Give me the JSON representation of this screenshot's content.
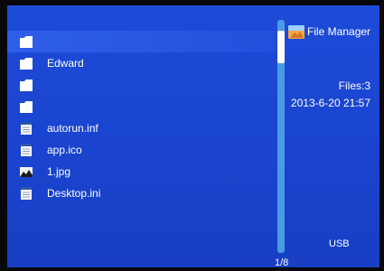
{
  "app": {
    "title": "File Manager",
    "icon": "file-manager-icon"
  },
  "files": [
    {
      "name": "",
      "icon": "folder-icon",
      "selected": true
    },
    {
      "name": "Edward",
      "icon": "folder-icon",
      "selected": false
    },
    {
      "name": "",
      "icon": "folder-icon",
      "selected": false
    },
    {
      "name": "",
      "icon": "folder-icon",
      "selected": false
    },
    {
      "name": "autorun.inf",
      "icon": "document-icon",
      "selected": false
    },
    {
      "name": "app.ico",
      "icon": "document-icon",
      "selected": false
    },
    {
      "name": "1.jpg",
      "icon": "image-icon",
      "selected": false
    },
    {
      "name": "Desktop.ini",
      "icon": "document-icon",
      "selected": false
    }
  ],
  "info": {
    "files_count": "Files:3",
    "datetime": "2013-6-20 21:57",
    "device": "USB"
  },
  "pagination": {
    "indicator": "1/8"
  },
  "colors": {
    "background": "#1a44cf",
    "scrollbar_track": "#4a9be6",
    "scrollbar_thumb": "#ffffff",
    "text": "#ffffff"
  }
}
